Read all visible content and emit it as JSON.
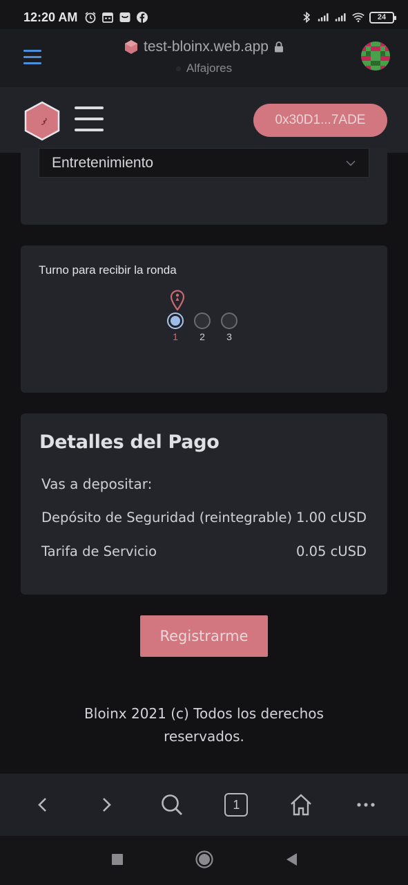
{
  "status_bar": {
    "time": "12:20 AM",
    "battery": "24",
    "left_icons": [
      "alarm-icon",
      "calendar-icon",
      "shopping-icon",
      "facebook-icon"
    ],
    "right_icons": [
      "bluetooth-icon",
      "signal-icon",
      "signal-icon",
      "wifi-icon",
      "battery-icon"
    ]
  },
  "browser": {
    "url": "test-bloinx.web.app",
    "network": "Alfajores"
  },
  "header": {
    "wallet_address": "0x30D1...7ADE"
  },
  "category": {
    "selected": "Entretenimiento"
  },
  "turn": {
    "title": "Turno para recibir la ronda",
    "options": [
      "1",
      "2",
      "3"
    ],
    "selected": "1"
  },
  "payment": {
    "title": "Detalles del Pago",
    "subtitle": "Vas a depositar:",
    "rows": [
      {
        "label": "Depósito de Seguridad (reintegrable)",
        "value": "1.00 cUSD"
      },
      {
        "label": "Tarifa de Servicio",
        "value": "0.05 cUSD"
      }
    ]
  },
  "register_button": "Registrarme",
  "footer": "Bloinx 2021 (c) Todos los derechos reservados.",
  "bottom_nav": {
    "tab_count": "1"
  },
  "colors": {
    "accent": "#d27780",
    "card_bg": "#24252b",
    "page_bg": "#121214",
    "link_blue": "#4a8fdc",
    "radio_selected": "#9cbde9"
  }
}
